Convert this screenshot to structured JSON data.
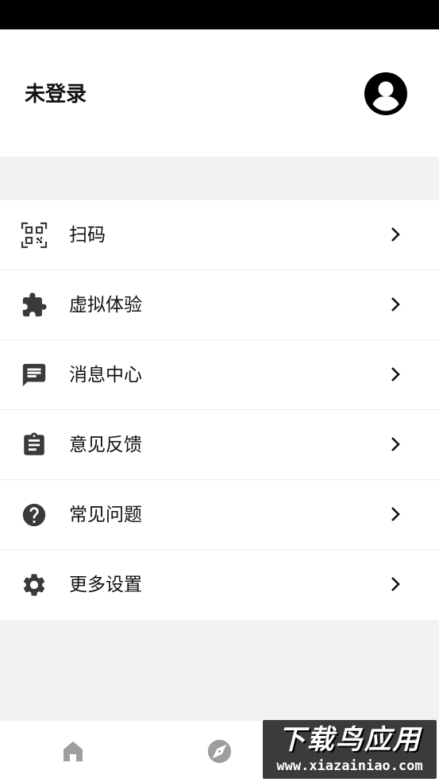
{
  "header": {
    "login_status": "未登录",
    "avatar_icon": "account-circle-icon"
  },
  "menu": {
    "items": [
      {
        "label": "扫码",
        "icon": "qr-scan-icon"
      },
      {
        "label": "虚拟体验",
        "icon": "puzzle-icon"
      },
      {
        "label": "消息中心",
        "icon": "message-icon"
      },
      {
        "label": "意见反馈",
        "icon": "clipboard-icon"
      },
      {
        "label": "常见问题",
        "icon": "help-circle-icon"
      },
      {
        "label": "更多设置",
        "icon": "gear-icon"
      }
    ]
  },
  "tabbar": {
    "tabs": [
      {
        "icon": "home-icon"
      },
      {
        "icon": "compass-icon"
      }
    ]
  },
  "watermark": {
    "title": "下载鸟应用",
    "url": "www.xiazainiao.com"
  },
  "colors": {
    "status_bar": "#000000",
    "background": "#f2f2f2",
    "icon": "#3a3a3a",
    "tab_icon": "#9e9e9e"
  }
}
